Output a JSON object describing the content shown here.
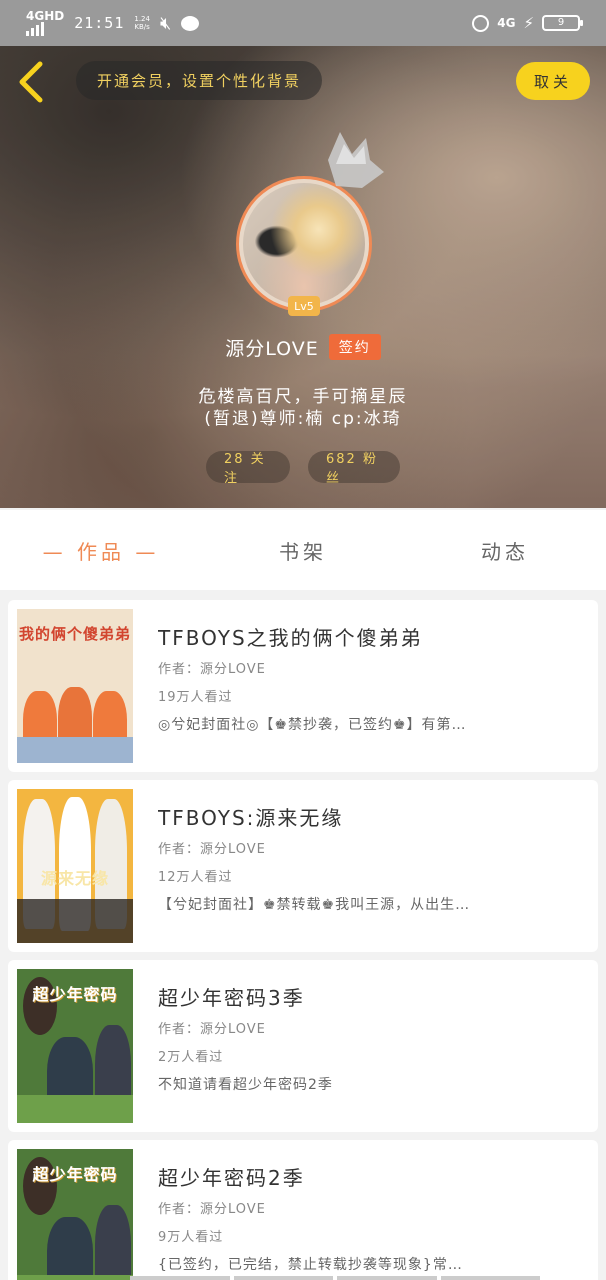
{
  "status_bar": {
    "network": "4GHD",
    "time": "21:51",
    "speed_top": "1.24",
    "speed_bottom": "KB/s",
    "network_right": "4G",
    "battery": "9",
    "icons": [
      "signal-icon",
      "mute-icon",
      "chat-bubble-icon",
      "alarm-icon",
      "charging-bolt-icon",
      "battery-icon"
    ]
  },
  "header": {
    "back_icon": "chevron-left-icon",
    "vip_banner": "开通会员，设置个性化背景",
    "unfollow_label": "取关",
    "accent_color": "#f7d21e"
  },
  "profile": {
    "level": "Lv5",
    "username": "源分LOVE",
    "signed_label": "签约",
    "bio_line1": "危楼高百尺，手可摘星辰",
    "bio_line2": "(暂退)尊师:楠 cp:冰琦",
    "follow_stat": "28 关注",
    "fans_stat": "682 粉丝"
  },
  "tabs": [
    {
      "label": "— 作品 —",
      "active": true
    },
    {
      "label": "书架",
      "active": false
    },
    {
      "label": "动态",
      "active": false
    }
  ],
  "works": [
    {
      "title": "TFBOYS之我的俩个傻弟弟",
      "author": "作者：源分LOVE",
      "views": "19万人看过",
      "desc": "◎兮妃封面社◎【♚禁抄袭，已签约♚】有第…",
      "cover_text": "我的俩个傻弟弟",
      "cover_color": "#f1e2cc"
    },
    {
      "title": "TFBOYS:源来无缘",
      "author": "作者：源分LOVE",
      "views": "12万人看过",
      "desc": "【兮妃封面社】♚禁转载♚我叫王源，从出生…",
      "cover_text": "源来无缘",
      "cover_color": "#f3b640"
    },
    {
      "title": "超少年密码3季",
      "author": "作者：源分LOVE",
      "views": "2万人看过",
      "desc": "不知道请看超少年密码2季",
      "cover_text": "超少年密码",
      "cover_color": "#4f7a3a"
    },
    {
      "title": "超少年密码2季",
      "author": "作者：源分LOVE",
      "views": "9万人看过",
      "desc": "{已签约，已完结，禁止转载抄袭等现象}常…",
      "cover_text": "超少年密码",
      "cover_color": "#4f7a3a"
    }
  ]
}
